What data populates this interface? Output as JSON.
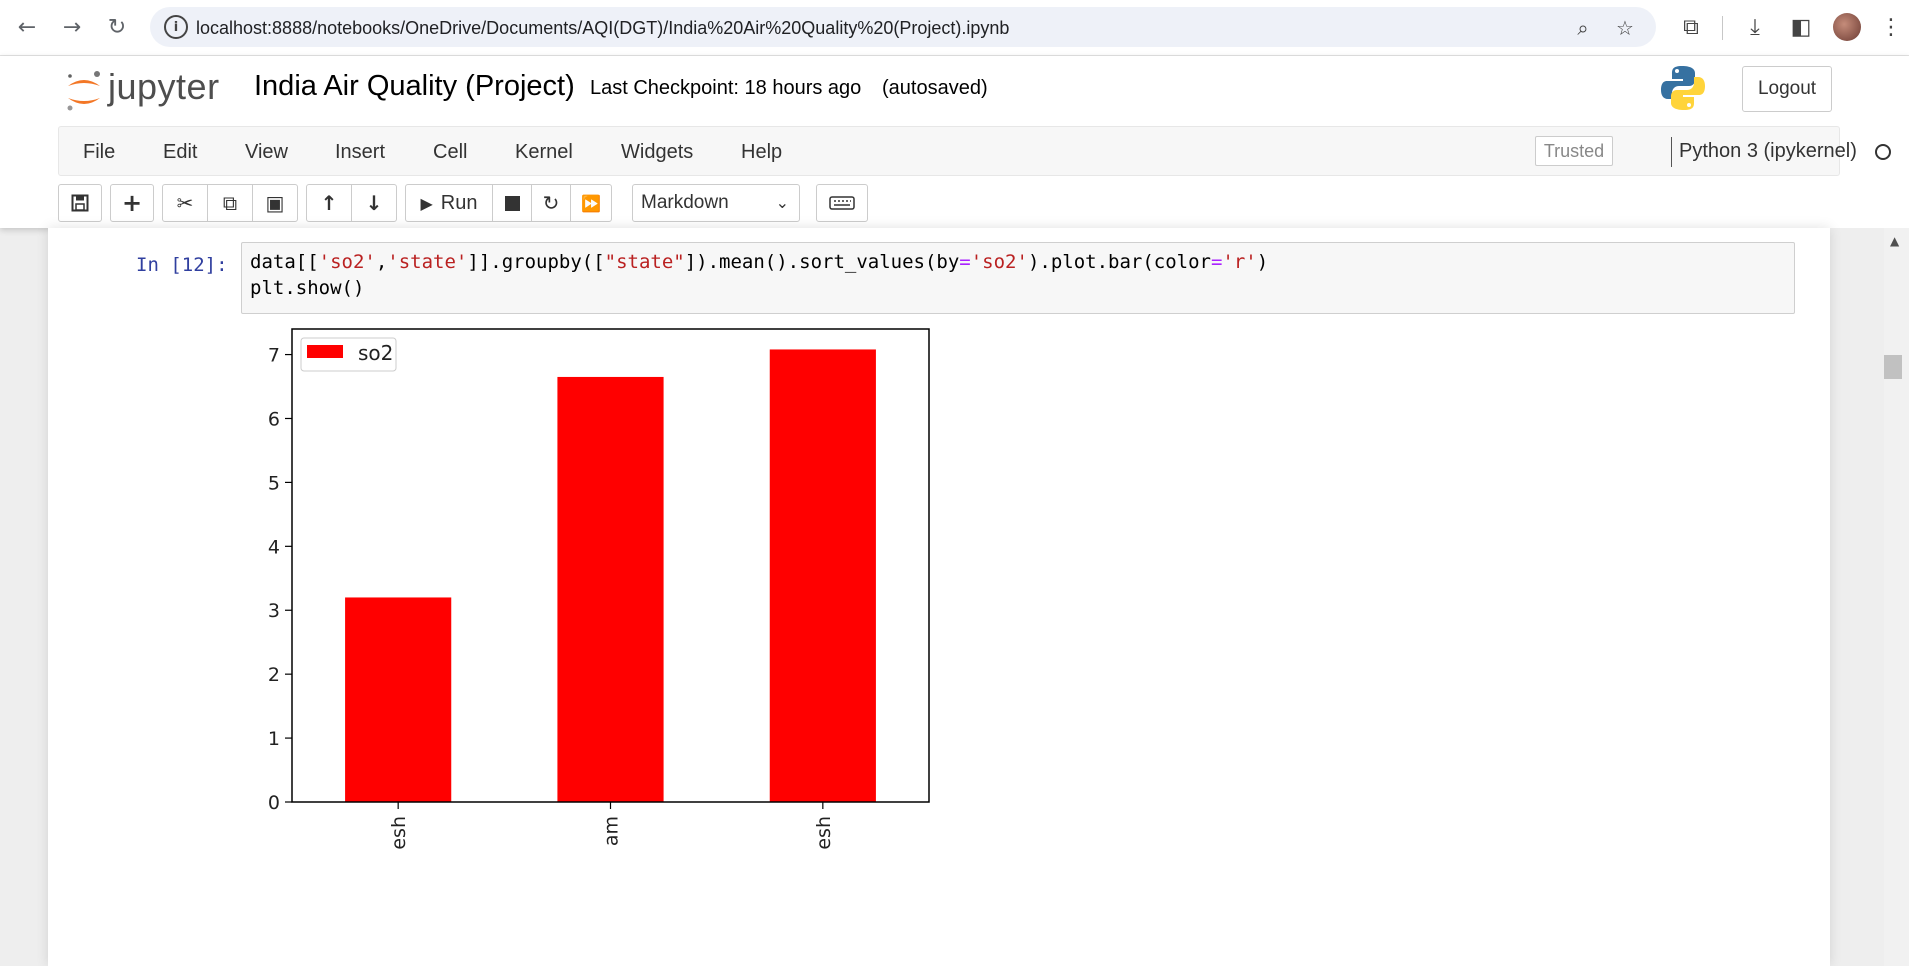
{
  "browser": {
    "url": "localhost:8888/notebooks/OneDrive/Documents/AQI(DGT)/India%20Air%20Quality%20(Project).ipynb",
    "back_icon": "arrow-left-icon",
    "forward_icon": "arrow-right-icon",
    "reload_icon": "reload-icon"
  },
  "header": {
    "logo_text": "jupyter",
    "notebook_title": "India Air Quality (Project)",
    "checkpoint": "Last Checkpoint: 18 hours ago",
    "autosave": "(autosaved)",
    "logout_label": "Logout"
  },
  "menu": {
    "items": [
      "File",
      "Edit",
      "View",
      "Insert",
      "Cell",
      "Kernel",
      "Widgets",
      "Help"
    ],
    "trusted": "Trusted",
    "kernel": "Python 3 (ipykernel)"
  },
  "toolbar": {
    "run_label": "Run",
    "cell_type": "Markdown"
  },
  "cell": {
    "prompt": "In [12]:",
    "code": [
      "data[['so2','state']].groupby([\"state\"]).mean().sort_values(by='so2').plot.bar(color='r')",
      "plt.show()"
    ]
  },
  "chart_data": {
    "type": "bar",
    "categories": [
      "esh",
      "am",
      "esh"
    ],
    "series": [
      {
        "name": "so2",
        "values": [
          3.2,
          6.65,
          7.08
        ],
        "color": "#ff0000"
      }
    ],
    "ylim": [
      0,
      7.4
    ],
    "yticks": [
      0,
      1,
      2,
      3,
      4,
      5,
      6,
      7
    ],
    "legend": "top-left",
    "grid": false
  }
}
